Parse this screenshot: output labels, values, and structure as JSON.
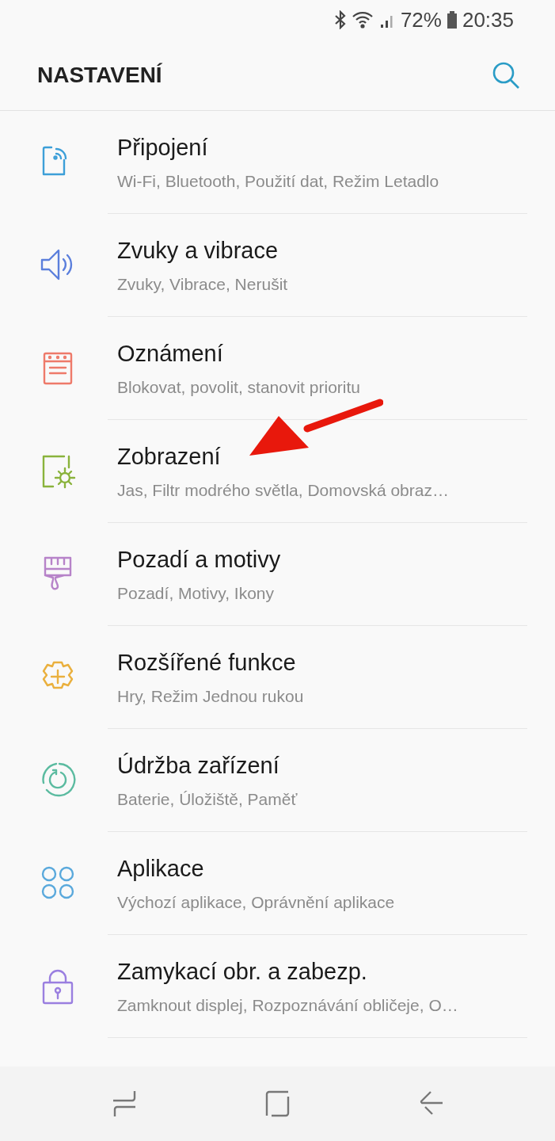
{
  "status_bar": {
    "battery": "72%",
    "time": "20:35"
  },
  "header": {
    "title": "NASTAVENÍ"
  },
  "items": [
    {
      "color": "#3d9fd8",
      "title": "Připojení",
      "subtitle": "Wi-Fi, Bluetooth, Použití dat, Režim Letadlo"
    },
    {
      "color": "#5b7fdc",
      "title": "Zvuky a vibrace",
      "subtitle": "Zvuky, Vibrace, Nerušit"
    },
    {
      "color": "#ee7a6a",
      "title": "Oznámení",
      "subtitle": "Blokovat, povolit, stanovit prioritu"
    },
    {
      "color": "#8ab33c",
      "title": "Zobrazení",
      "subtitle": "Jas, Filtr modrého světla, Domovská obraz…"
    },
    {
      "color": "#b783c9",
      "title": "Pozadí a motivy",
      "subtitle": "Pozadí, Motivy, Ikony"
    },
    {
      "color": "#eab03e",
      "title": "Rozšířené funkce",
      "subtitle": "Hry, Režim Jednou rukou"
    },
    {
      "color": "#5bbba0",
      "title": "Údržba zařízení",
      "subtitle": "Baterie, Úložiště, Paměť"
    },
    {
      "color": "#5aa9dc",
      "title": "Aplikace",
      "subtitle": "Výchozí aplikace, Oprávnění aplikace"
    },
    {
      "color": "#9a7fe0",
      "title": "Zamykací obr. a zabezp.",
      "subtitle": "Zamknout displej, Rozpoznávání obličeje, O…"
    }
  ]
}
